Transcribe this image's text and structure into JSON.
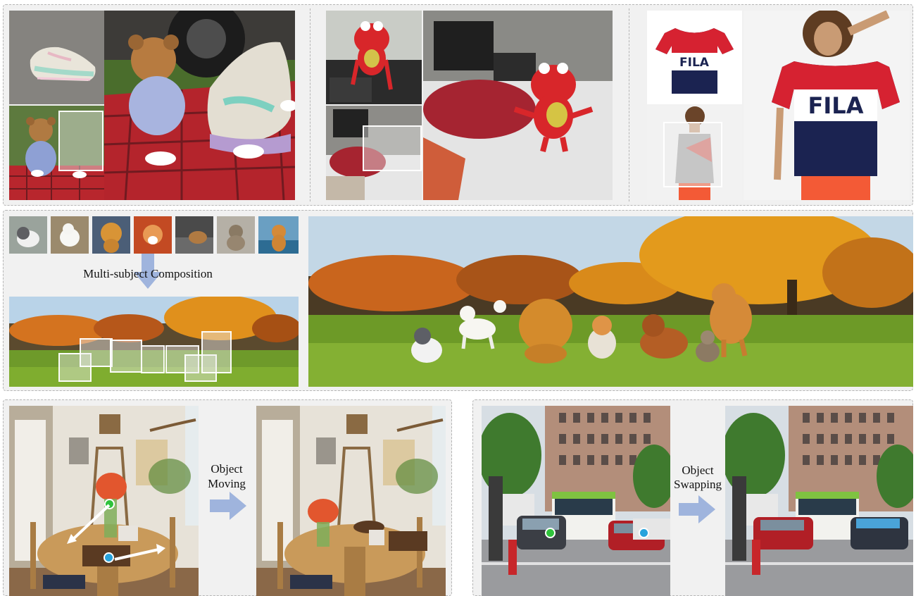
{
  "labels": {
    "composition": "Multi-subject Composition",
    "moving": [
      "Object",
      "Moving"
    ],
    "swapping": [
      "Object",
      "Swapping"
    ]
  },
  "brand_text": "FILA",
  "colors": {
    "panel_bg": "#f1f1f1",
    "panel_border": "#b5b5b5",
    "arrow": "#9fb4dd",
    "dot_green": "#2fc23b",
    "dot_blue": "#27a3dc"
  }
}
